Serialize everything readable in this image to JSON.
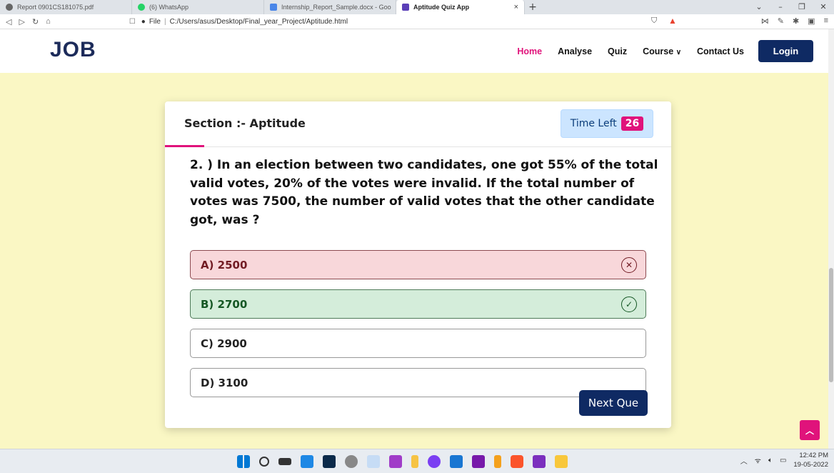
{
  "browser": {
    "tabs": [
      {
        "label": "Report 0901CS181075.pdf",
        "color": "#444"
      },
      {
        "label": "(6) WhatsApp",
        "color": "#25d366"
      },
      {
        "label": "Internship_Report_Sample.docx - Goo",
        "color": "#4a86e8"
      },
      {
        "label": "Aptitude Quiz App",
        "color": "#5b3fb8",
        "active": true
      }
    ],
    "tab_close": "×",
    "new_tab": "+",
    "url_prefix": "File",
    "url": "C:/Users/asus/Desktop/Final_year_Project/Aptitude.html"
  },
  "site": {
    "logo": "JOB",
    "nav": {
      "home": "Home",
      "analyse": "Analyse",
      "quiz": "Quiz",
      "course": "Course",
      "contact": "Contact Us"
    },
    "login": "Login"
  },
  "quiz": {
    "section": "Section :- Aptitude",
    "time_label": "Time Left",
    "time_value": "26",
    "question": "2. ) In an election between two candidates, one got 55% of the total valid votes, 20% of the votes were invalid. If the total number of votes was 7500, the number of valid votes that the other candidate got, was ?",
    "options": [
      {
        "label": "A) 2500",
        "state": "wrong"
      },
      {
        "label": "B) 2700",
        "state": "correct"
      },
      {
        "label": "C) 2900",
        "state": "none"
      },
      {
        "label": "D) 3100",
        "state": "none"
      }
    ],
    "next": "Next Que"
  },
  "taskbar": {
    "time": "12:42 PM",
    "date": "19-05-2022"
  }
}
